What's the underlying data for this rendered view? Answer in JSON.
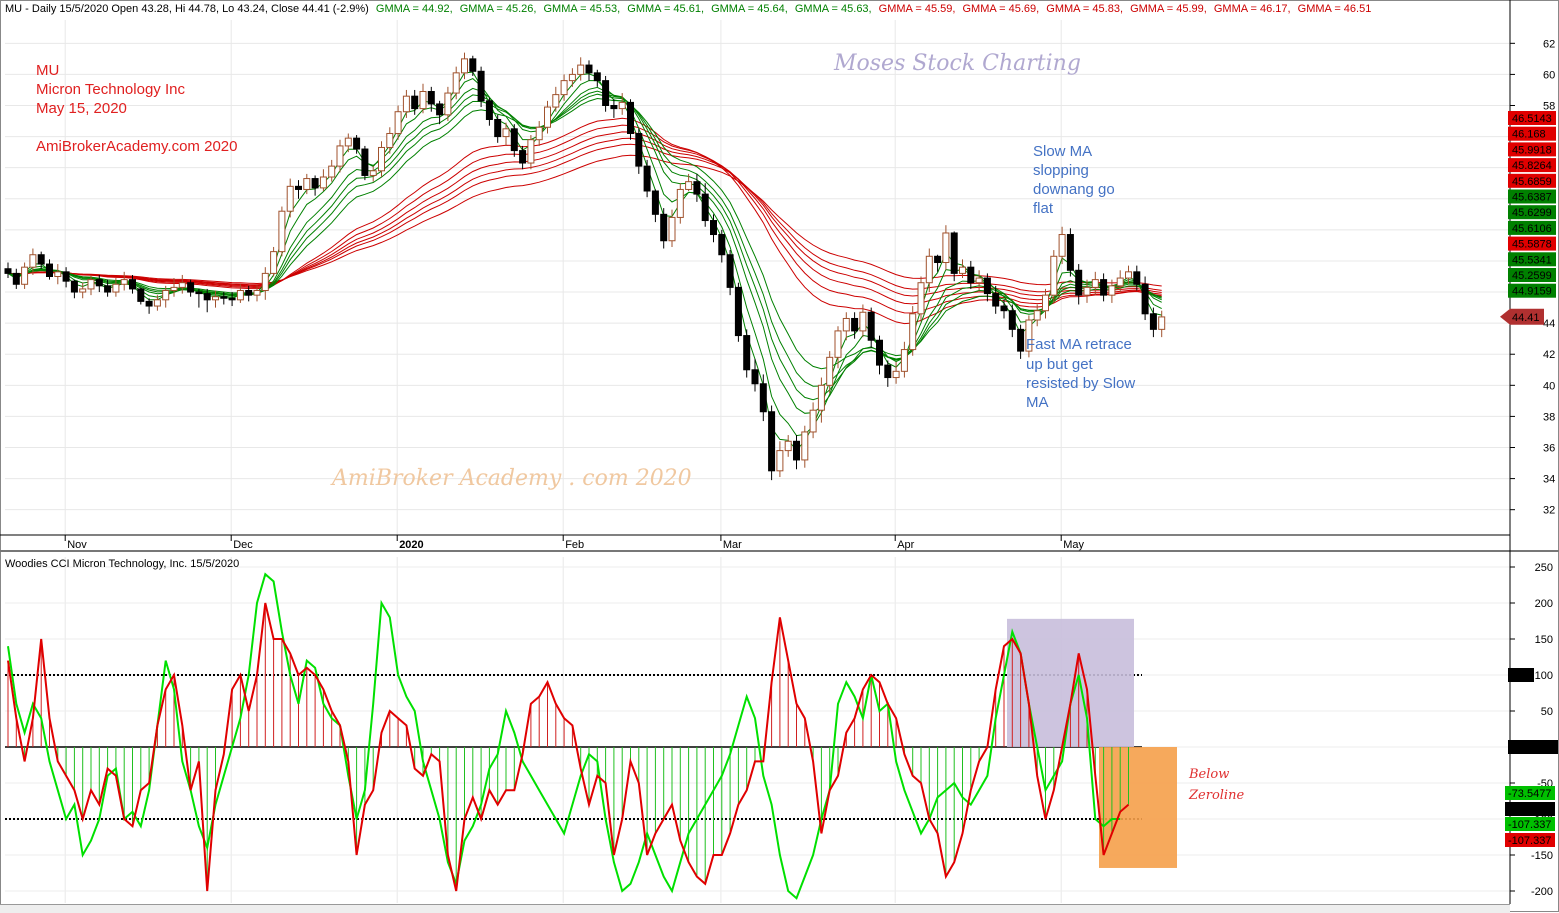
{
  "header": {
    "title_plain": "MU - Daily 15/5/2020 Open 43.28, Hi 44.78, Lo 43.24, Close 44.41 (-2.9%)",
    "gmma_items": [
      {
        "text": "GMMA = 44.92,",
        "color": "#008000"
      },
      {
        "text": "GMMA = 45.26,",
        "color": "#008000"
      },
      {
        "text": "GMMA = 45.53,",
        "color": "#008000"
      },
      {
        "text": "GMMA = 45.61,",
        "color": "#008000"
      },
      {
        "text": "GMMA = 45.64,",
        "color": "#008000"
      },
      {
        "text": "GMMA = 45.63,",
        "color": "#008000"
      },
      {
        "text": "GMMA = 45.59,",
        "color": "#cc0000"
      },
      {
        "text": "GMMA = 45.69,",
        "color": "#cc0000"
      },
      {
        "text": "GMMA = 45.83,",
        "color": "#cc0000"
      },
      {
        "text": "GMMA = 45.99,",
        "color": "#cc0000"
      },
      {
        "text": "GMMA = 46.17,",
        "color": "#cc0000"
      },
      {
        "text": "GMMA = 46.51",
        "color": "#cc0000"
      }
    ]
  },
  "info": {
    "symbol": "MU",
    "company": "Micron Technology Inc",
    "date": "May 15, 2020",
    "site": "AmiBrokerAcademy.com  2020"
  },
  "watermarks": {
    "moses": "Moses Stock Charting",
    "academy": "AmiBroker Academy . com  2020"
  },
  "annotations": {
    "slow_ma": [
      "Slow MA",
      "slopping",
      "downang go",
      "flat"
    ],
    "fast_ma": [
      "Fast MA retrace",
      "up but get",
      "resisted by Slow",
      "MA"
    ],
    "below_zero": [
      "Below",
      "Zeroline"
    ]
  },
  "cci_title": "Woodies CCI  Micron Technology, Inc. 15/5/2020",
  "colors": {
    "up_candle": "#a0522d",
    "down_candle": "#000000",
    "gmma_short": "#008000",
    "gmma_long": "#cc0000",
    "cci_line": "#00e000",
    "turbo_line": "#e00000",
    "annotation_blue": "#4472c4",
    "annotation_red": "#e02020",
    "purple_box": "#c8bedc",
    "orange_box": "#f5a04a"
  },
  "chart_data": [
    {
      "type": "candlestick",
      "title": "MU - Daily",
      "ylim": [
        30.5,
        63.5
      ],
      "y_ticks": [
        32,
        34,
        36,
        38,
        40,
        42,
        44,
        46,
        48,
        50,
        52,
        54,
        56,
        58,
        60,
        62
      ],
      "x_tick_labels": [
        {
          "label": "Nov",
          "index": 4
        },
        {
          "label": "Dec",
          "index": 24
        },
        {
          "label": "2020",
          "index": 44
        },
        {
          "label": "Feb",
          "index": 64
        },
        {
          "label": "Mar",
          "index": 83
        },
        {
          "label": "Apr",
          "index": 104
        },
        {
          "label": "May",
          "index": 124
        }
      ],
      "start": 47.5,
      "closes": [
        47.2,
        46.5,
        47.6,
        48.4,
        47.8,
        47.0,
        47.3,
        46.7,
        46.0,
        46.2,
        46.8,
        46.4,
        46.0,
        46.5,
        46.8,
        46.2,
        45.4,
        45.1,
        45.5,
        46.1,
        46.3,
        46.6,
        46.0,
        45.9,
        45.5,
        45.7,
        45.6,
        45.5,
        46.1,
        45.8,
        46.1,
        47.2,
        48.6,
        51.2,
        52.8,
        52.6,
        53.3,
        52.7,
        53.4,
        54.1,
        55.4,
        55.9,
        55.2,
        53.5,
        53.8,
        55.3,
        56.2,
        57.6,
        58.6,
        57.8,
        58.9,
        58.1,
        57.4,
        58.8,
        60.1,
        61.0,
        60.2,
        58.3,
        57.1,
        56.0,
        56.5,
        55.1,
        54.3,
        55.8,
        56.6,
        57.9,
        58.7,
        59.6,
        60.0,
        60.6,
        60.1,
        59.6,
        58.0,
        57.8,
        58.2,
        56.2,
        54.1,
        52.5,
        51.0,
        49.3,
        50.8,
        52.6,
        53.1,
        52.3,
        50.6,
        49.7,
        48.4,
        46.3,
        43.2,
        41.0,
        40.1,
        38.3,
        34.5,
        35.8,
        36.4,
        35.2,
        37.0,
        38.4,
        40.0,
        41.8,
        43.5,
        44.3,
        43.5,
        44.7,
        42.9,
        41.3,
        40.5,
        40.9,
        42.3,
        44.6,
        46.6,
        48.3,
        47.9,
        49.8,
        47.2,
        47.6,
        46.6,
        46.9,
        45.9,
        45.1,
        44.8,
        43.6,
        42.2,
        44.2,
        44.8,
        45.8,
        48.3,
        49.7,
        47.4,
        45.8,
        46.3,
        46.8,
        45.8,
        46.4,
        46.9,
        47.3,
        46.5,
        44.6,
        43.6,
        44.4
      ],
      "highs": [
        47.9,
        47.5,
        47.9,
        48.8,
        48.6,
        48.1,
        47.8,
        47.6,
        46.8,
        46.6,
        47.1,
        47.1,
        46.8,
        46.9,
        47.3,
        47.1,
        46.3,
        45.6,
        45.8,
        46.4,
        46.9,
        47.1,
        46.8,
        46.2,
        46.2,
        46.1,
        46.0,
        46.0,
        46.5,
        46.4,
        46.4,
        47.6,
        48.9,
        51.5,
        53.3,
        53.2,
        53.6,
        53.5,
        53.9,
        54.5,
        55.8,
        56.2,
        56.1,
        55.4,
        54.1,
        55.7,
        56.6,
        58.0,
        59.0,
        59.0,
        59.4,
        59.2,
        58.3,
        59.2,
        60.5,
        61.4,
        61.2,
        60.5,
        58.5,
        57.4,
        56.9,
        56.8,
        55.4,
        56.1,
        57.0,
        58.3,
        59.2,
        60.0,
        60.4,
        61.1,
        60.9,
        60.3,
        59.9,
        58.4,
        58.8,
        58.4,
        56.5,
        54.5,
        52.6,
        51.4,
        51.3,
        53.0,
        53.6,
        53.6,
        53.0,
        51.0,
        50.0,
        48.7,
        46.6,
        43.6,
        41.7,
        40.7,
        38.7,
        36.4,
        36.8,
        36.8,
        37.4,
        38.9,
        40.5,
        42.2,
        43.8,
        44.7,
        44.7,
        45.2,
        45.0,
        43.2,
        41.6,
        41.5,
        42.8,
        45.1,
        47.0,
        48.8,
        48.4,
        50.3,
        49.9,
        48.1,
        48.0,
        47.4,
        47.2,
        46.4,
        45.5,
        45.2,
        43.9,
        44.5,
        45.2,
        46.2,
        48.7,
        50.2,
        50.1,
        47.8,
        46.8,
        47.3,
        47.2,
        46.8,
        47.4,
        47.7,
        47.7,
        47.0,
        45.0,
        44.8
      ],
      "lows": [
        46.9,
        46.2,
        46.2,
        47.1,
        47.5,
        46.8,
        46.5,
        46.3,
        45.6,
        45.6,
        45.8,
        46.0,
        45.7,
        45.7,
        46.1,
        45.9,
        45.2,
        44.6,
        44.8,
        45.0,
        45.7,
        45.9,
        45.7,
        45.0,
        44.7,
        45.0,
        45.2,
        45.1,
        45.3,
        45.4,
        45.4,
        45.5,
        47.0,
        48.3,
        50.8,
        52.0,
        52.3,
        52.2,
        52.5,
        53.1,
        53.7,
        55.0,
        54.9,
        53.2,
        53.1,
        53.4,
        54.9,
        55.8,
        57.2,
        57.4,
        57.5,
        57.6,
        56.8,
        57.0,
        58.4,
        59.7,
        59.9,
        57.9,
        56.7,
        55.6,
        55.4,
        54.7,
        53.9,
        53.9,
        55.4,
        56.2,
        57.6,
        58.3,
        59.2,
        59.6,
        59.6,
        59.2,
        57.6,
        57.2,
        57.4,
        55.8,
        53.6,
        52.1,
        50.5,
        48.8,
        48.9,
        50.4,
        52.5,
        51.8,
        50.2,
        49.2,
        47.9,
        45.8,
        42.8,
        40.5,
        39.6,
        37.7,
        33.9,
        34.1,
        35.4,
        34.6,
        34.7,
        36.6,
        37.6,
        39.5,
        41.1,
        42.9,
        43.0,
        43.1,
        42.4,
        40.7,
        39.9,
        40.1,
        40.5,
        41.9,
        44.1,
        46.0,
        47.3,
        47.4,
        46.7,
        46.9,
        46.2,
        46.1,
        45.4,
        44.6,
        44.3,
        43.1,
        41.7,
        41.8,
        43.8,
        44.3,
        45.3,
        47.8,
        47.0,
        45.2,
        45.3,
        45.8,
        45.4,
        45.3,
        46.0,
        46.5,
        46.1,
        44.2,
        43.1,
        43.1
      ],
      "gmma_periods_short": [
        3,
        5,
        8,
        10,
        12,
        15
      ],
      "gmma_periods_long": [
        30,
        35,
        40,
        45,
        50,
        60
      ],
      "price_labels": [
        {
          "text": "46.5143",
          "color": "#e00000"
        },
        {
          "text": "46.168",
          "color": "#e00000"
        },
        {
          "text": "45.9918",
          "color": "#e00000"
        },
        {
          "text": "45.8264",
          "color": "#e00000"
        },
        {
          "text": "45.6859",
          "color": "#e00000"
        },
        {
          "text": "45.6387",
          "color": "#008000"
        },
        {
          "text": "45.6299",
          "color": "#008000"
        },
        {
          "text": "45.6106",
          "color": "#008000"
        },
        {
          "text": "45.5878",
          "color": "#e00000"
        },
        {
          "text": "45.5341",
          "color": "#008000"
        },
        {
          "text": "45.2599",
          "color": "#008000"
        },
        {
          "text": "44.9159",
          "color": "#008000"
        }
      ],
      "last_price": "44.41"
    },
    {
      "type": "line",
      "title": "Woodies CCI",
      "ylim": [
        -215,
        260
      ],
      "y_ticks": [
        -200,
        -150,
        -100,
        -50,
        0,
        50,
        100,
        150,
        200,
        250
      ],
      "y_tick_labels": [
        "-200",
        "-150",
        "-100",
        "-50",
        "0",
        "50",
        "100",
        "150",
        "200",
        "250"
      ],
      "levels": [
        100,
        0,
        -100
      ],
      "series": [
        {
          "values": [
            120,
            40,
            -20,
            40,
            150,
            40,
            -20,
            -40,
            -60,
            -100,
            -60,
            -80,
            -30,
            -40,
            -100,
            -110,
            -60,
            -50,
            30,
            80,
            100,
            30,
            -60,
            -20,
            -200,
            -60,
            -10,
            80,
            100,
            50,
            100,
            200,
            150,
            150,
            130,
            100,
            110,
            100,
            80,
            50,
            30,
            -20,
            -150,
            -80,
            -60,
            20,
            50,
            40,
            30,
            -30,
            -40,
            -10,
            -20,
            -150,
            -200,
            -100,
            -70,
            -100,
            -60,
            -80,
            -60,
            -60,
            -10,
            60,
            70,
            90,
            60,
            40,
            30,
            -30,
            -80,
            -40,
            -50,
            -150,
            -100,
            -20,
            -50,
            -150,
            -120,
            -100,
            -80,
            -130,
            -160,
            -180,
            -190,
            -150,
            -150,
            -120,
            -80,
            -60,
            -20,
            -20,
            90,
            180,
            120,
            60,
            40,
            -20,
            -120,
            -60,
            -40,
            20,
            40,
            80,
            100,
            90,
            60,
            40,
            -10,
            -40,
            -50,
            -100,
            -120,
            -180,
            -160,
            -120,
            -60,
            -20,
            0,
            80,
            140,
            150,
            130,
            60,
            -40,
            -100,
            -60,
            0,
            60,
            130,
            80,
            -40,
            -150,
            -120,
            -90,
            -80
          ]
        },
        {
          "values": [
            140,
            60,
            20,
            60,
            40,
            -20,
            -60,
            -100,
            -80,
            -150,
            -130,
            -100,
            -40,
            -30,
            -100,
            -90,
            -110,
            -60,
            30,
            120,
            80,
            -20,
            -60,
            -110,
            -140,
            -80,
            -40,
            0,
            40,
            100,
            200,
            240,
            230,
            160,
            100,
            60,
            120,
            110,
            60,
            40,
            30,
            -40,
            -100,
            -60,
            60,
            200,
            180,
            100,
            70,
            50,
            -20,
            -60,
            -100,
            -160,
            -190,
            -130,
            -110,
            -80,
            -30,
            -10,
            50,
            20,
            -20,
            -40,
            -60,
            -80,
            -100,
            -120,
            -80,
            -40,
            -10,
            -20,
            -100,
            -160,
            -200,
            -190,
            -160,
            -120,
            -150,
            -180,
            -200,
            -160,
            -120,
            -100,
            -80,
            -60,
            -40,
            -10,
            30,
            70,
            40,
            -40,
            -80,
            -150,
            -200,
            -210,
            -180,
            -150,
            -100,
            -60,
            60,
            90,
            70,
            40,
            100,
            50,
            60,
            -20,
            -60,
            -90,
            -120,
            -100,
            -70,
            -60,
            -50,
            -70,
            -80,
            -60,
            -40,
            40,
            100,
            160,
            130,
            60,
            0,
            -60,
            -40,
            -20,
            60,
            100,
            40,
            -100,
            -110,
            -100,
            -100
          ]
        }
      ],
      "right_labels": [
        "-73.5477",
        "-100",
        "-107.337",
        "-107.337"
      ],
      "level_labels": [
        "100",
        "0.00000"
      ]
    }
  ]
}
